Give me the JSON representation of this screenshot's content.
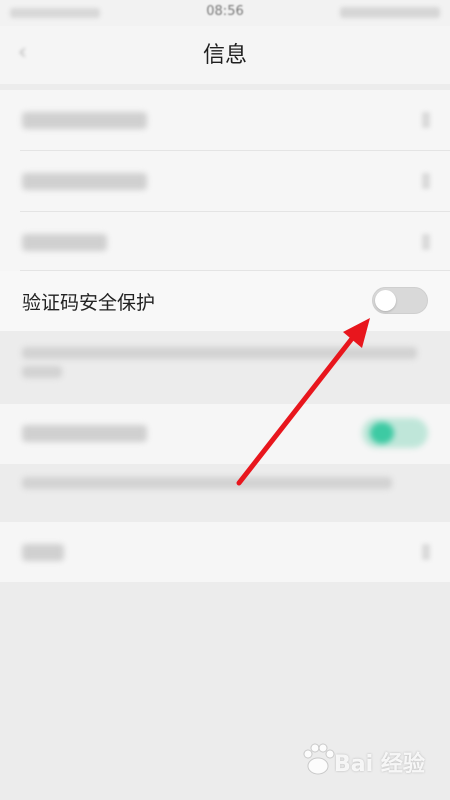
{
  "status_bar": {
    "time": "08:56"
  },
  "header": {
    "title": "信息"
  },
  "settings": {
    "verification_code_protection": {
      "label": "验证码安全保护",
      "toggle_on": false
    }
  },
  "watermark": {
    "text": "Bai 经验"
  },
  "colors": {
    "arrow": "#e8161d",
    "toggle_off": "#d9d9d9",
    "toggle_on_blurred": "#3dcaa3",
    "background": "#ececec"
  }
}
